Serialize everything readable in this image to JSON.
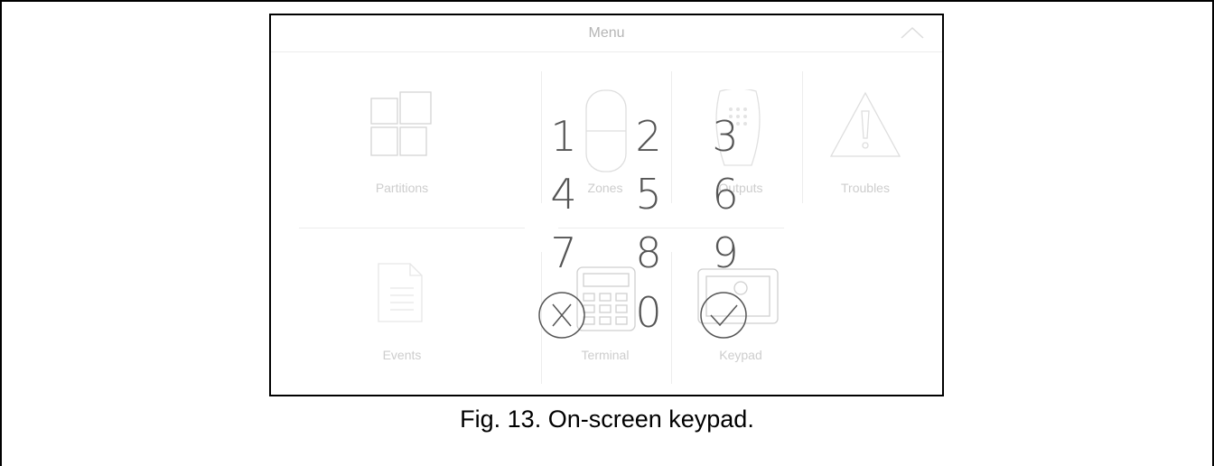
{
  "menu": {
    "title": "Menu",
    "tiles": [
      {
        "label": "Partitions",
        "icon": "partitions-icon"
      },
      {
        "label": "Zones",
        "icon": "zones-icon"
      },
      {
        "label": "Outputs",
        "icon": "outputs-icon"
      },
      {
        "label": "Troubles",
        "icon": "troubles-icon"
      },
      {
        "label": "Events",
        "icon": "events-icon"
      },
      {
        "label": "Terminal",
        "icon": "terminal-icon"
      },
      {
        "label": "Keypad",
        "icon": "keypad-icon"
      }
    ]
  },
  "keypad": {
    "keys": [
      "1",
      "2",
      "3",
      "4",
      "5",
      "6",
      "7",
      "8",
      "9",
      "0"
    ],
    "cancel_icon": "cancel-icon",
    "confirm_icon": "confirm-icon"
  },
  "caption": "Fig. 13. On-screen keypad.",
  "colors": {
    "key_text": "#555555",
    "faded_label": "#cdcdcd",
    "frame": "#000000"
  }
}
